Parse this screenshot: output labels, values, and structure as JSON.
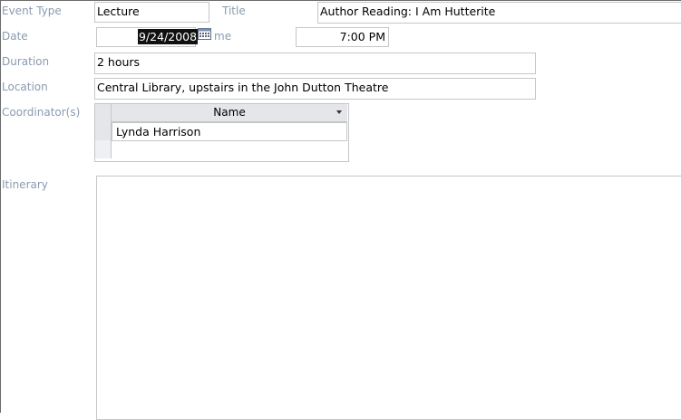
{
  "form": {
    "event_type": {
      "label": "Event Type",
      "value": "Lecture"
    },
    "title": {
      "label": "Title",
      "value": "Author Reading: I Am Hutterite"
    },
    "date": {
      "label": "Date",
      "value": "9/24/2008"
    },
    "time": {
      "label": "me",
      "value": "7:00 PM"
    },
    "duration": {
      "label": "Duration",
      "value": "2 hours"
    },
    "location": {
      "label": "Location",
      "value": "Central Library, upstairs in the John Dutton Theatre"
    },
    "coordinators": {
      "label": "Coordinator(s)",
      "column_header": "Name",
      "rows": [
        "Lynda Harrison"
      ]
    },
    "itinerary": {
      "label": "Itinerary",
      "value": ""
    }
  },
  "icons": {
    "calendar": "calendar-icon",
    "dropdown": "chevron-down-icon"
  },
  "colors": {
    "label_text": "#8a9bb0",
    "field_border": "#c6c6c6",
    "selection_bg": "#111111"
  }
}
